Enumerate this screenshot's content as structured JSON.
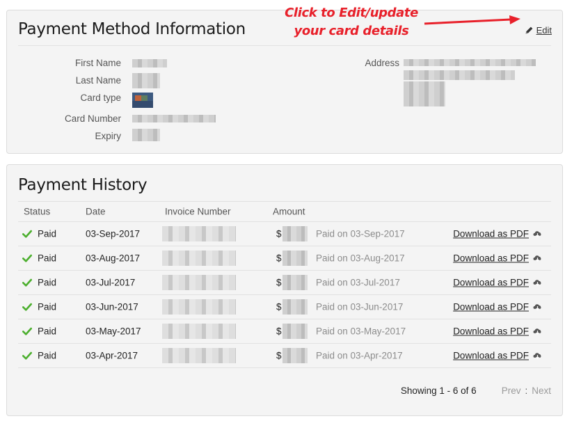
{
  "payment_method": {
    "title": "Payment Method Information",
    "edit_label": "Edit",
    "callout": "Click to Edit/update your card details",
    "fields": {
      "first_name": "First Name",
      "last_name": "Last Name",
      "card_type": "Card type",
      "card_number": "Card Number",
      "expiry": "Expiry",
      "address": "Address"
    }
  },
  "payment_history": {
    "title": "Payment History",
    "columns": [
      "Status",
      "Date",
      "Invoice Number",
      "Amount"
    ],
    "rows": [
      {
        "status": "Paid",
        "date": "03-Sep-2017",
        "currency": "$",
        "paid_on": "Paid on 03-Sep-2017",
        "download": "Download as PDF"
      },
      {
        "status": "Paid",
        "date": "03-Aug-2017",
        "currency": "$",
        "paid_on": "Paid on 03-Aug-2017",
        "download": "Download as PDF"
      },
      {
        "status": "Paid",
        "date": "03-Jul-2017",
        "currency": "$",
        "paid_on": "Paid on 03-Jul-2017",
        "download": "Download as PDF"
      },
      {
        "status": "Paid",
        "date": "03-Jun-2017",
        "currency": "$",
        "paid_on": "Paid on 03-Jun-2017",
        "download": "Download as PDF"
      },
      {
        "status": "Paid",
        "date": "03-May-2017",
        "currency": "$",
        "paid_on": "Paid on 03-May-2017",
        "download": "Download as PDF"
      },
      {
        "status": "Paid",
        "date": "03-Apr-2017",
        "currency": "$",
        "paid_on": "Paid on 03-Apr-2017",
        "download": "Download as PDF"
      }
    ],
    "pager": {
      "showing": "Showing 1 - 6 of 6",
      "prev": "Prev",
      "separator": ":",
      "next": "Next"
    }
  },
  "colors": {
    "callout": "#e8202a",
    "check": "#4caf2e",
    "panel_bg": "#f4f4f4"
  },
  "icons": [
    "pencil-icon",
    "check-icon",
    "cloud-download-icon",
    "arrow-icon"
  ]
}
